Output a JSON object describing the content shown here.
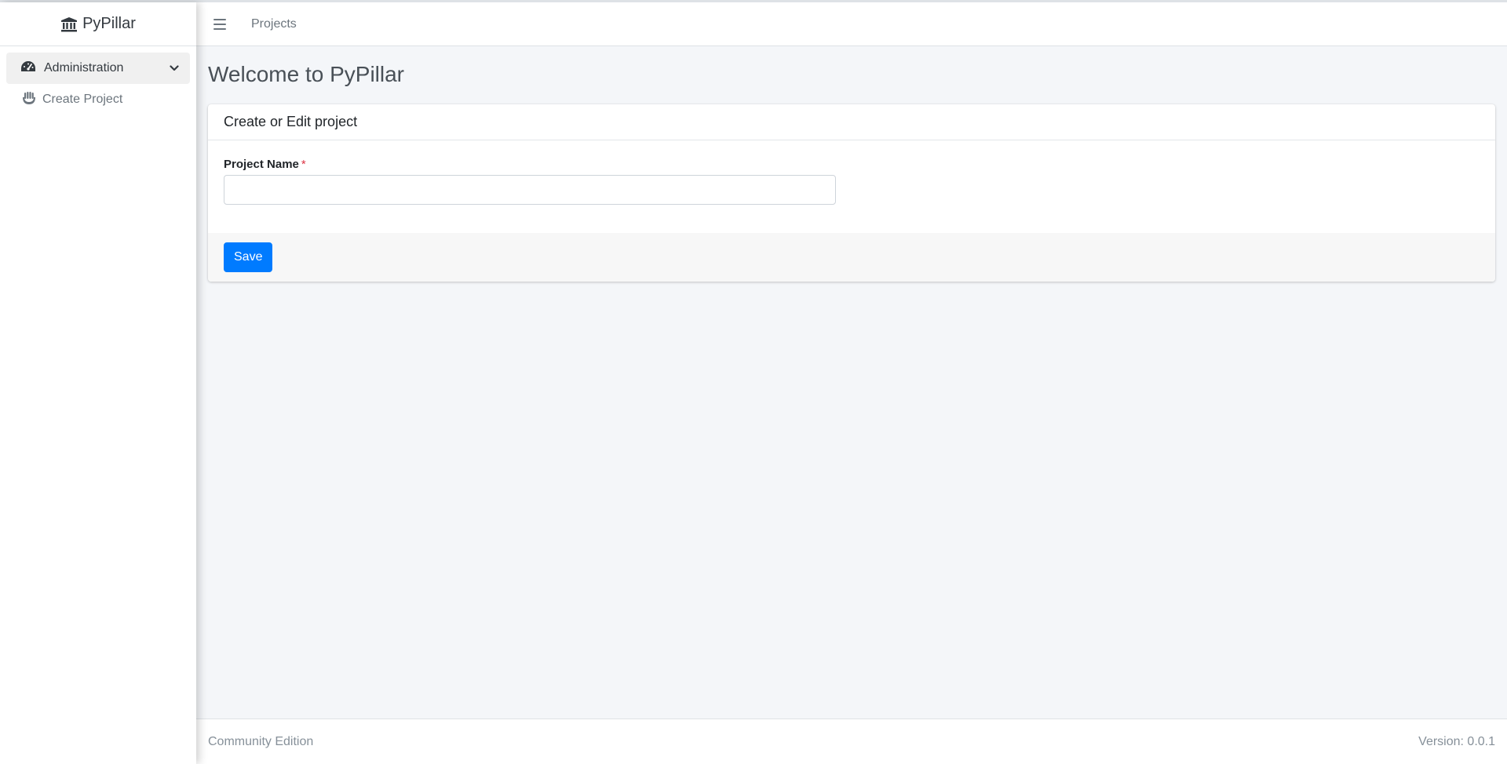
{
  "app": {
    "brand": "PyPillar"
  },
  "sidebar": {
    "items": [
      {
        "label": "Administration",
        "icon": "tachometer-icon",
        "expanded": true
      },
      {
        "label": "Create Project",
        "icon": "hand-icon"
      }
    ]
  },
  "header": {
    "breadcrumb": "Projects"
  },
  "page": {
    "title": "Welcome to PyPillar"
  },
  "card": {
    "title": "Create or Edit project",
    "field_label": "Project Name",
    "required_marker": "*",
    "field_value": "",
    "save_label": "Save"
  },
  "footer": {
    "edition": "Community Edition",
    "version": "Version: 0.0.1"
  },
  "colors": {
    "primary": "#007bff",
    "required": "#dc3545",
    "content_bg": "#f4f6f9"
  }
}
